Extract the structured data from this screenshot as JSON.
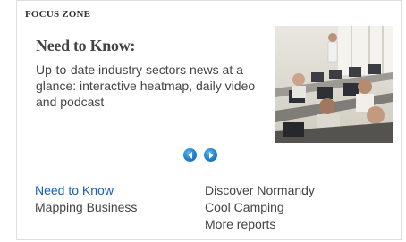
{
  "section_label": "FOCUS ZONE",
  "feature": {
    "title": "Need to Know:",
    "description": "Up-to-date industry sectors news at a glance: interactive heatmap, daily video and podcast"
  },
  "pager": {
    "prev_icon": "chevron-left-icon",
    "next_icon": "chevron-right-icon"
  },
  "links": {
    "col1": [
      "Need to Know",
      "Mapping Business"
    ],
    "col2": [
      "Discover Normandy",
      "Cool Camping",
      "More reports"
    ]
  },
  "colors": {
    "active_link": "#1a5fb4",
    "text": "#444444",
    "pager_button": "#1f7fcc"
  }
}
